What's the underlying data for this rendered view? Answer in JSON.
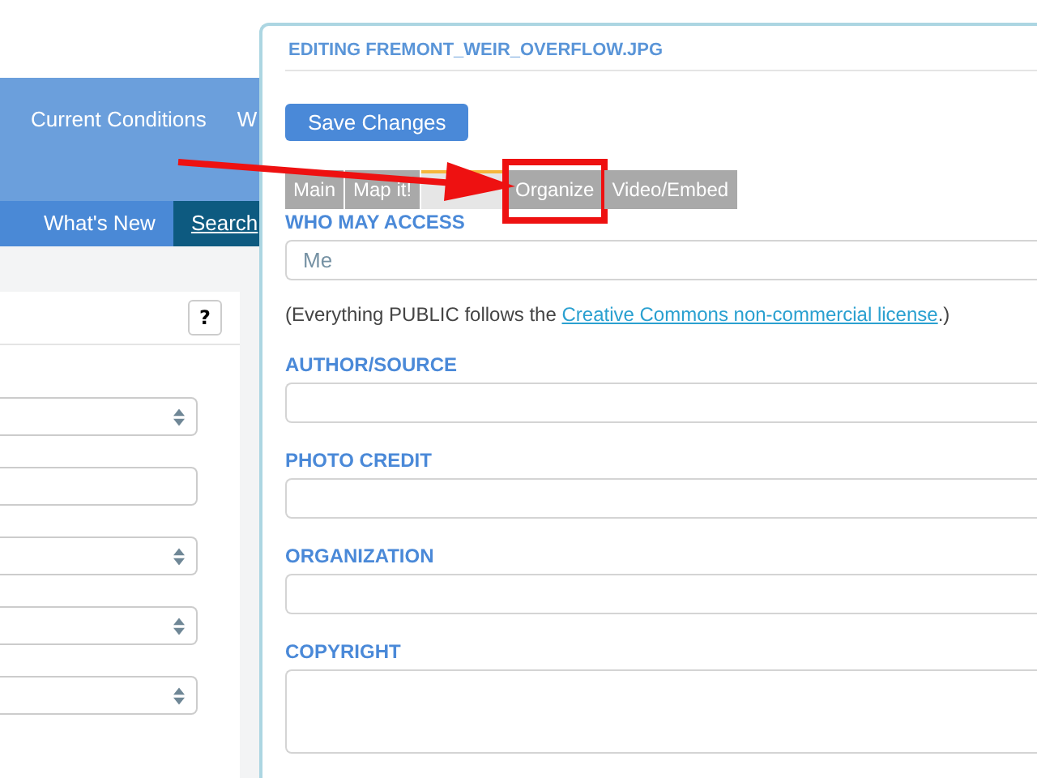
{
  "background_page": {
    "nav_items": [
      {
        "label": "Current Conditions"
      },
      {
        "label": "W"
      }
    ],
    "subnav_items": [
      {
        "label": "What's New",
        "selected": false
      },
      {
        "label": "Search",
        "selected": true
      }
    ],
    "help_button": "?",
    "side_fields": [
      {
        "kind": "select"
      },
      {
        "kind": "input"
      },
      {
        "kind": "select"
      },
      {
        "kind": "select"
      },
      {
        "kind": "select"
      }
    ]
  },
  "dialog": {
    "title": "EDITING FREMONT_WEIR_OVERFLOW.JPG",
    "save_button": "Save Changes",
    "tabs": [
      {
        "label": "Main",
        "selected": false,
        "highlighted": false
      },
      {
        "label": "Map it!",
        "selected": false,
        "highlighted": false
      },
      {
        "selected": true,
        "highlighted": false
      },
      {
        "label": "Organize",
        "selected": false,
        "highlighted": true
      },
      {
        "label": "Video/Embed",
        "selected": false,
        "highlighted": false
      }
    ],
    "fields": [
      {
        "kind": "input",
        "label": "WHO MAY ACCESS",
        "value": "Me"
      },
      {
        "kind": "note",
        "before": "(Everything PUBLIC follows the ",
        "link": "Creative Commons non-commercial license",
        "after": ".)"
      },
      {
        "kind": "input",
        "label": "AUTHOR/SOURCE"
      },
      {
        "kind": "input",
        "label": "PHOTO CREDIT"
      },
      {
        "kind": "input",
        "label": "ORGANIZATION"
      },
      {
        "kind": "textarea",
        "label": "COPYRIGHT"
      }
    ]
  }
}
